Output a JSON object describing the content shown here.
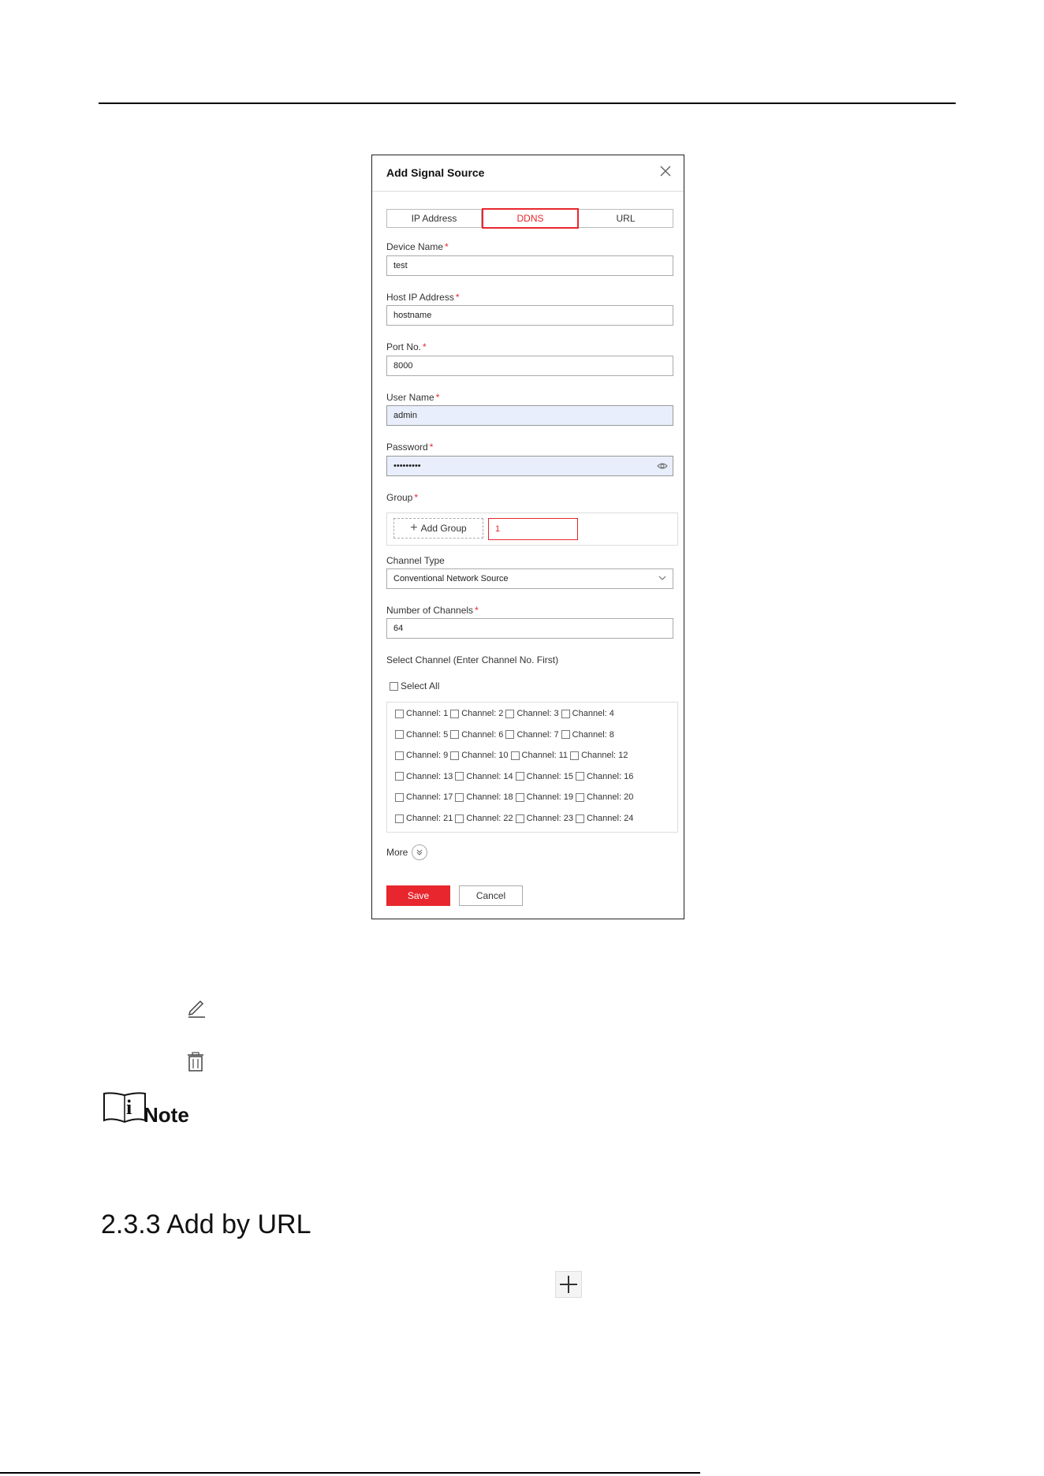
{
  "dialog": {
    "title": "Add Signal Source",
    "tabs": [
      {
        "label": "IP Address",
        "active": false
      },
      {
        "label": "DDNS",
        "active": true
      },
      {
        "label": "URL",
        "active": false
      }
    ],
    "fields": {
      "device_name": {
        "label": "Device Name",
        "value": "test"
      },
      "host_ip": {
        "label": "Host IP Address",
        "value": "hostname"
      },
      "port": {
        "label": "Port No.",
        "value": "8000"
      },
      "user_name": {
        "label": "User Name",
        "value": "admin"
      },
      "password": {
        "label": "Password",
        "value": "•••••••••"
      },
      "group": {
        "label": "Group",
        "add_label": "Add Group",
        "value": "1"
      },
      "channel_type": {
        "label": "Channel Type",
        "value": "Conventional Network Source"
      },
      "num_channels": {
        "label": "Number of Channels",
        "value": "64"
      }
    },
    "required_mark": "*",
    "select_channel": {
      "label": "Select Channel (Enter Channel No. First)",
      "select_all": "Select All",
      "channels": [
        [
          "Channel: 1",
          "Channel: 2",
          "Channel: 3",
          "Channel: 4"
        ],
        [
          "Channel: 5",
          "Channel: 6",
          "Channel: 7",
          "Channel: 8"
        ],
        [
          "Channel: 9",
          "Channel: 10",
          "Channel: 11",
          "Channel: 12"
        ],
        [
          "Channel: 13",
          "Channel: 14",
          "Channel: 15",
          "Channel: 16"
        ],
        [
          "Channel: 17",
          "Channel: 18",
          "Channel: 19",
          "Channel: 20"
        ],
        [
          "Channel: 21",
          "Channel: 22",
          "Channel: 23",
          "Channel: 24"
        ]
      ]
    },
    "more_label": "More",
    "save_label": "Save",
    "cancel_label": "Cancel"
  },
  "page": {
    "note_label": "Note",
    "section_heading": "2.3.3 Add by URL",
    "icons": [
      "edit-icon",
      "delete-icon",
      "note-icon",
      "plus-icon"
    ]
  },
  "colors": {
    "accent": "#e8262d",
    "filled_input": "#e8eefb"
  }
}
